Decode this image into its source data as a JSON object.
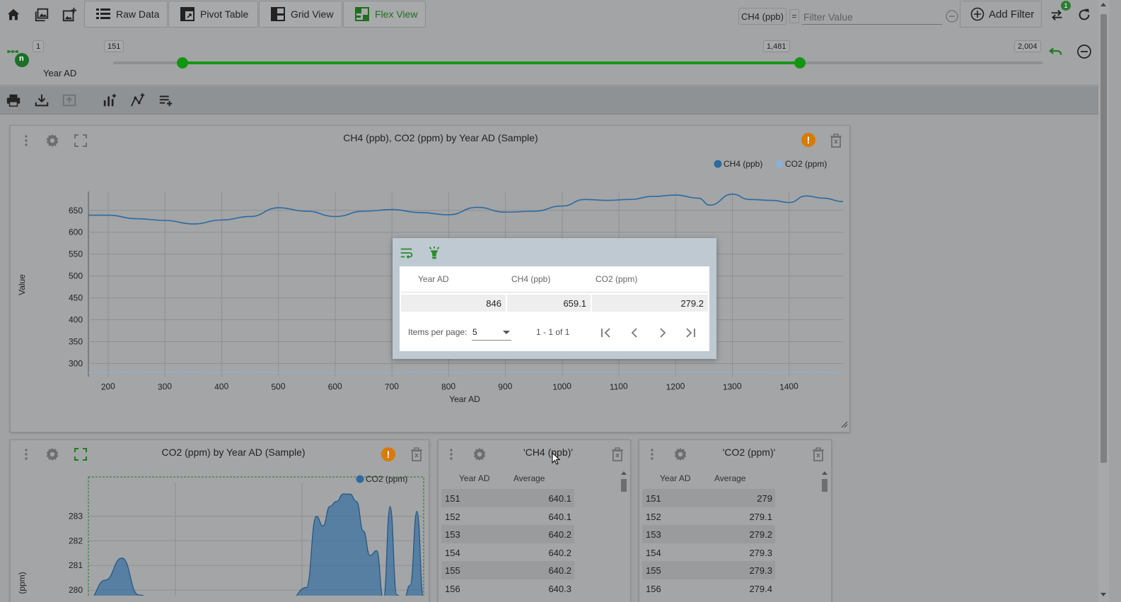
{
  "toolbar": {
    "views": [
      {
        "label": "Raw Data",
        "icon": "table-list-icon"
      },
      {
        "label": "Pivot Table",
        "icon": "pivot-table-icon"
      },
      {
        "label": "Grid View",
        "icon": "grid-view-icon"
      },
      {
        "label": "Flex View",
        "icon": "flex-view-icon",
        "active": true
      }
    ],
    "filter_field": "CH4 (ppb)",
    "filter_operator": "=",
    "filter_placeholder": "Filter Value",
    "add_filter_label": "Add Filter",
    "notification_count": "1"
  },
  "slider": {
    "min_label": "1",
    "max_label": "2,004",
    "low_label": "151",
    "high_label": "1,481",
    "min": 1,
    "max": 2004,
    "low": 151,
    "high": 1481,
    "field_label": "Year AD",
    "field_badge": "n"
  },
  "main_chart": {
    "title": "CH4  (ppb), CO2  (ppm) by Year AD (Sample)",
    "legend": [
      "CH4 (ppb)",
      "CO2 (ppm)"
    ],
    "xlabel": "Year AD",
    "ylabel": "Value"
  },
  "popup": {
    "headers": [
      "Year AD",
      "CH4 (ppb)",
      "CO2 (ppm)"
    ],
    "row": [
      "846",
      "659.1",
      "279.2"
    ],
    "items_per_page_label": "Items per page:",
    "items_per_page": "5",
    "range_text": "1 - 1 of 1"
  },
  "co2_chart": {
    "title": "CO2  (ppm) by Year AD (Sample)",
    "legend": "CO2 (ppm)",
    "ylabel": "(ppm)"
  },
  "ch4_table": {
    "title": "'CH4  (ppb)'",
    "headers": [
      "Year AD",
      "Average"
    ],
    "rows": [
      [
        "151",
        "640.1"
      ],
      [
        "152",
        "640.1"
      ],
      [
        "153",
        "640.2"
      ],
      [
        "154",
        "640.2"
      ],
      [
        "155",
        "640.2"
      ],
      [
        "156",
        "640.3"
      ]
    ]
  },
  "co2_table": {
    "title": "'CO2  (ppm)'",
    "headers": [
      "Year AD",
      "Average"
    ],
    "rows": [
      [
        "151",
        "279"
      ],
      [
        "152",
        "279.1"
      ],
      [
        "153",
        "279.2"
      ],
      [
        "154",
        "279.3"
      ],
      [
        "155",
        "279.3"
      ],
      [
        "156",
        "279.4"
      ]
    ]
  },
  "chart_data": [
    {
      "type": "line",
      "title": "CH4  (ppb), CO2  (ppm) by Year AD (Sample)",
      "xlabel": "Year AD",
      "ylabel": "Value",
      "xlim": [
        165,
        1495
      ],
      "ylim": [
        270,
        690
      ],
      "x_ticks": [
        200,
        300,
        400,
        500,
        600,
        700,
        800,
        900,
        1000,
        1100,
        1200,
        1300,
        1400
      ],
      "y_ticks": [
        300,
        350,
        400,
        450,
        500,
        550,
        600,
        650
      ],
      "legend_position": "top-right",
      "grid": true,
      "series": [
        {
          "name": "CH4 (ppb)",
          "color": "#2c6aa0",
          "x": [
            165,
            200,
            250,
            300,
            350,
            400,
            450,
            500,
            550,
            600,
            650,
            700,
            750,
            800,
            850,
            900,
            950,
            1000,
            1040,
            1080,
            1120,
            1160,
            1200,
            1240,
            1260,
            1300,
            1330,
            1370,
            1400,
            1430,
            1460,
            1495
          ],
          "y": [
            639,
            639,
            631,
            627,
            619,
            628,
            636,
            656,
            648,
            636,
            648,
            652,
            645,
            640,
            657,
            646,
            648,
            660,
            675,
            673,
            675,
            682,
            685,
            678,
            662,
            687,
            675,
            673,
            668,
            683,
            678,
            670
          ]
        },
        {
          "name": "CO2 (ppm)",
          "color": "#8fb0d4",
          "x": [
            165,
            300,
            500,
            700,
            900,
            1100,
            1300,
            1495
          ],
          "y": [
            279,
            280,
            279,
            279,
            280,
            280,
            280,
            279
          ]
        }
      ]
    },
    {
      "type": "area",
      "title": "CO2  (ppm) by Year AD (Sample)",
      "legend": "CO2 (ppm)",
      "ylabel": "(ppm)",
      "y_ticks": [
        280,
        281,
        282,
        283
      ],
      "ylim": [
        279.8,
        284.0
      ],
      "series": [
        {
          "name": "CO2 (ppm)",
          "color": "#2e6a9e",
          "x": [
            0,
            5,
            10,
            15,
            20,
            25,
            30,
            35,
            40,
            45,
            50,
            55,
            60,
            65,
            68,
            70,
            72,
            74,
            76,
            78,
            80,
            82,
            84,
            86,
            88,
            90,
            92,
            94,
            96,
            98,
            100
          ],
          "y": [
            279.6,
            280.4,
            281.3,
            279.8,
            279.6,
            279.6,
            279.6,
            279.7,
            279.6,
            279.6,
            279.6,
            279.6,
            279.6,
            280.1,
            283.0,
            282.6,
            283.4,
            283.6,
            283.9,
            283.9,
            283.6,
            282.4,
            281.4,
            281.6,
            279.6,
            283.4,
            279.8,
            279.6,
            280.2,
            283.2,
            279.6
          ]
        }
      ]
    }
  ]
}
